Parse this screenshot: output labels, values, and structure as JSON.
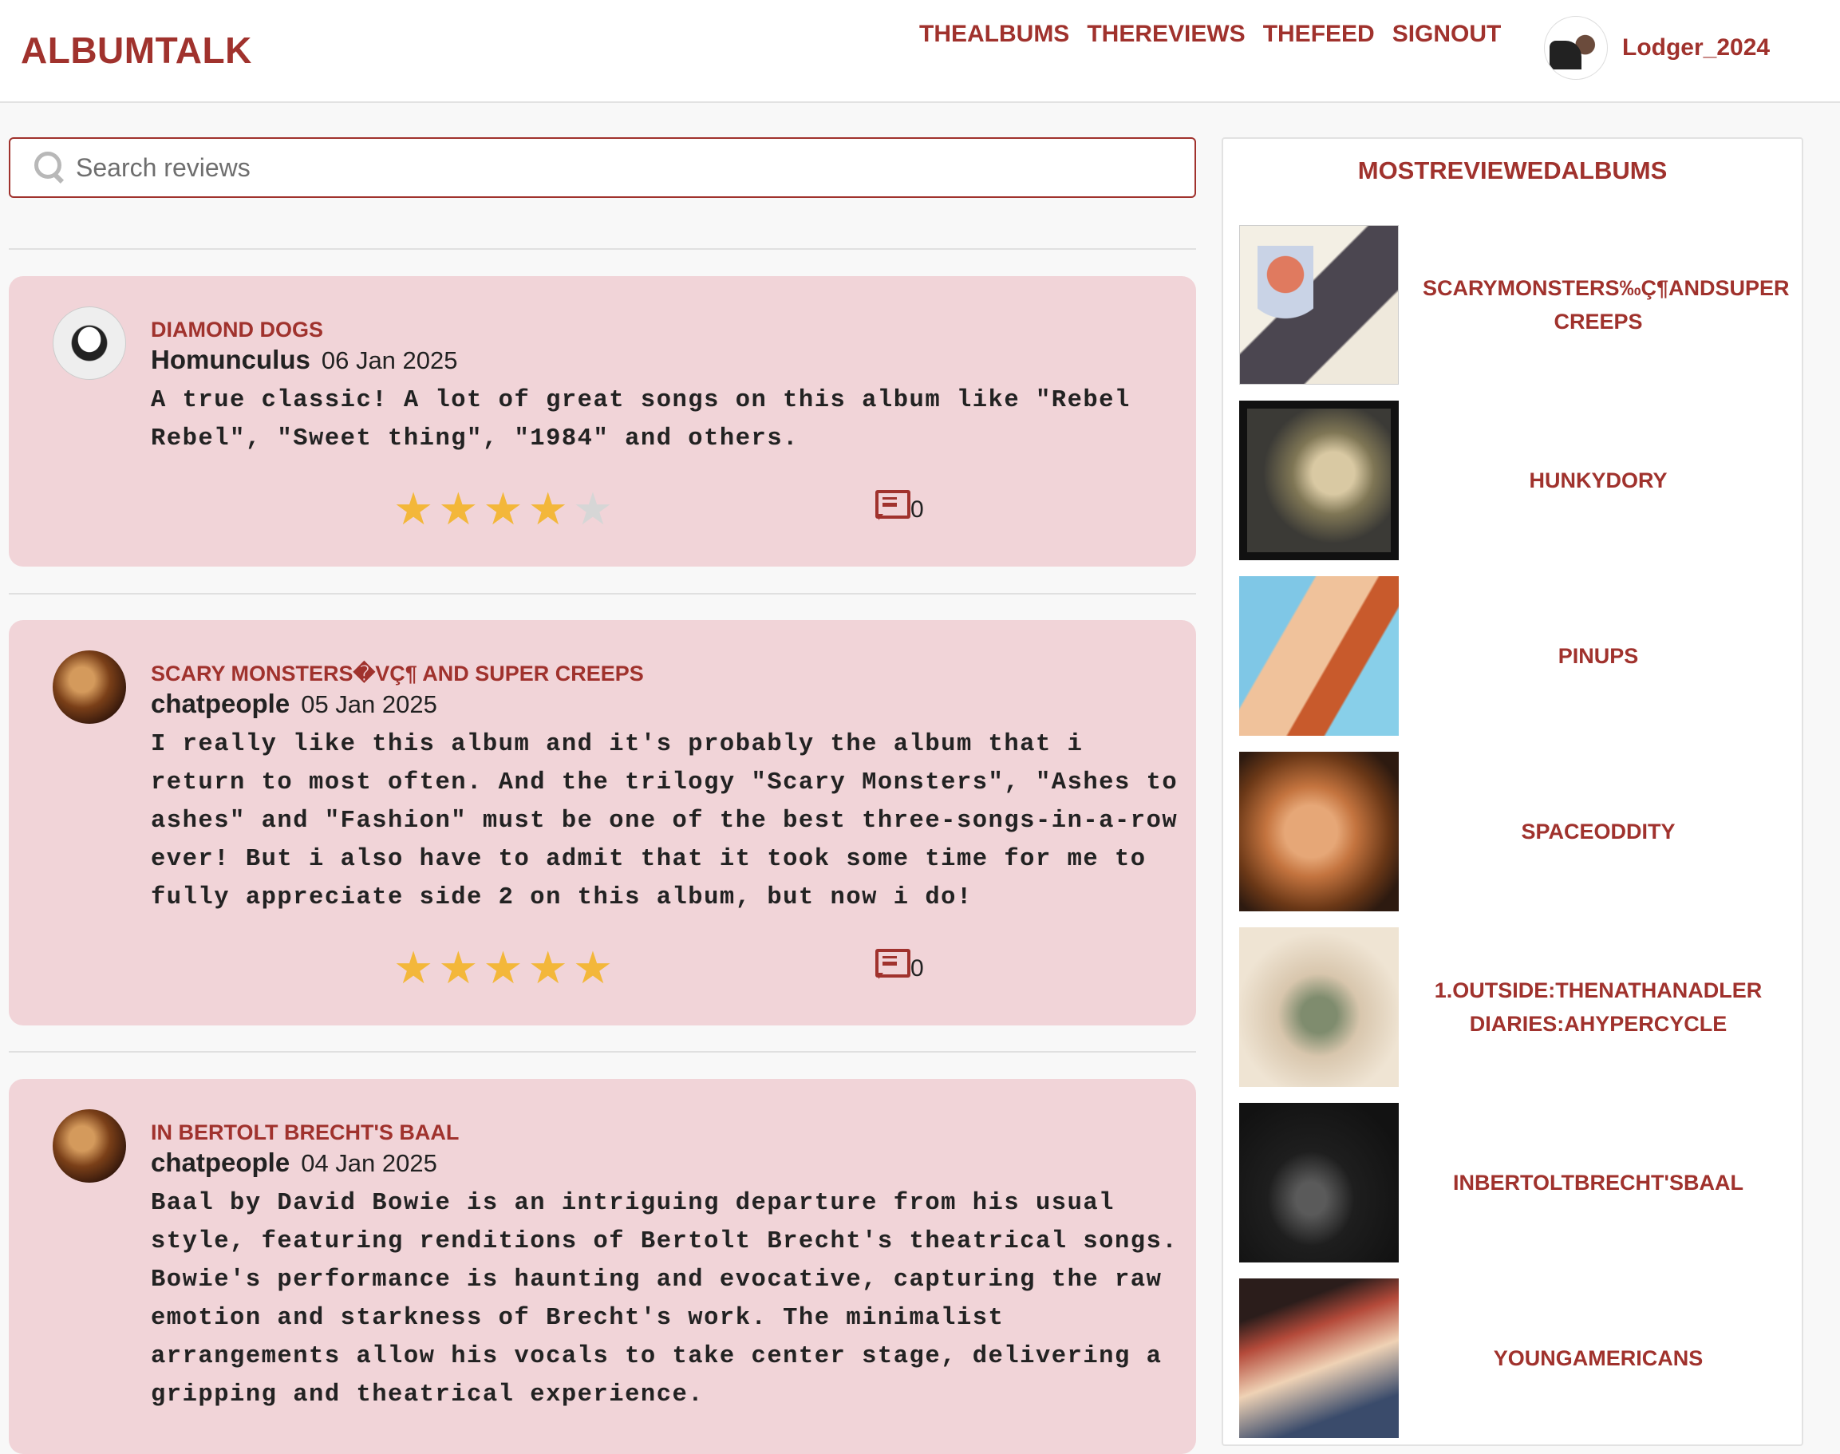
{
  "header": {
    "brand": "ALBUMTALK",
    "nav": [
      "THEALBUMS",
      "THEREVIEWS",
      "THEFEED",
      "SIGNOUT"
    ],
    "username": "Lodger_2024"
  },
  "search": {
    "placeholder": "Search reviews",
    "value": ""
  },
  "reviews": [
    {
      "album": "DIAMOND DOGS",
      "author": "Homunculus",
      "date": "06 Jan 2025",
      "text": "A true classic! A lot of great songs on this album like \"Rebel Rebel\", \"Sweet thing\", \"1984\" and others.",
      "rating": 4,
      "max_rating": 5,
      "comments": "0"
    },
    {
      "album": "SCARY MONSTERS�VÇ¶ AND SUPER CREEPS",
      "author": "chatpeople",
      "date": "05 Jan 2025",
      "text": "I really like this album and it's probably the album that i return to most often. And the trilogy \"Scary Monsters\", \"Ashes to ashes\" and \"Fashion\" must be one of the best three-songs-in-a-row ever! But i also have to admit that it took some time for me to fully appreciate side 2 on this album, but now i do!",
      "rating": 5,
      "max_rating": 5,
      "comments": "0"
    },
    {
      "album": "IN BERTOLT BRECHT'S BAAL",
      "author": "chatpeople",
      "date": "04 Jan 2025",
      "text": "Baal by David Bowie is an intriguing departure from his usual style, featuring renditions of Bertolt Brecht's theatrical songs. Bowie's performance is haunting and evocative, capturing the raw emotion and starkness of Brecht's work. The minimalist arrangements allow his vocals to take center stage, delivering a gripping and theatrical experience."
    }
  ],
  "sidebar": {
    "title": "MOSTREVIEWEDALBUMS",
    "albums": [
      {
        "name": "SCARYMONSTERS‰Ç¶ANDSUPER CREEPS"
      },
      {
        "name": "HUNKYDORY"
      },
      {
        "name": "PINUPS"
      },
      {
        "name": "SPACEODDITY"
      },
      {
        "name": "1.OUTSIDE:THENATHANADLER DIARIES:AHYPERCYCLE"
      },
      {
        "name": "INBERTOLTBRECHT'SBAAL"
      },
      {
        "name": "YOUNGAMERICANS"
      }
    ]
  },
  "colors": {
    "accent": "#a0322d",
    "card": "#f1d4d8",
    "star": "#f3b73a",
    "star_off": "#d6d6d6"
  }
}
